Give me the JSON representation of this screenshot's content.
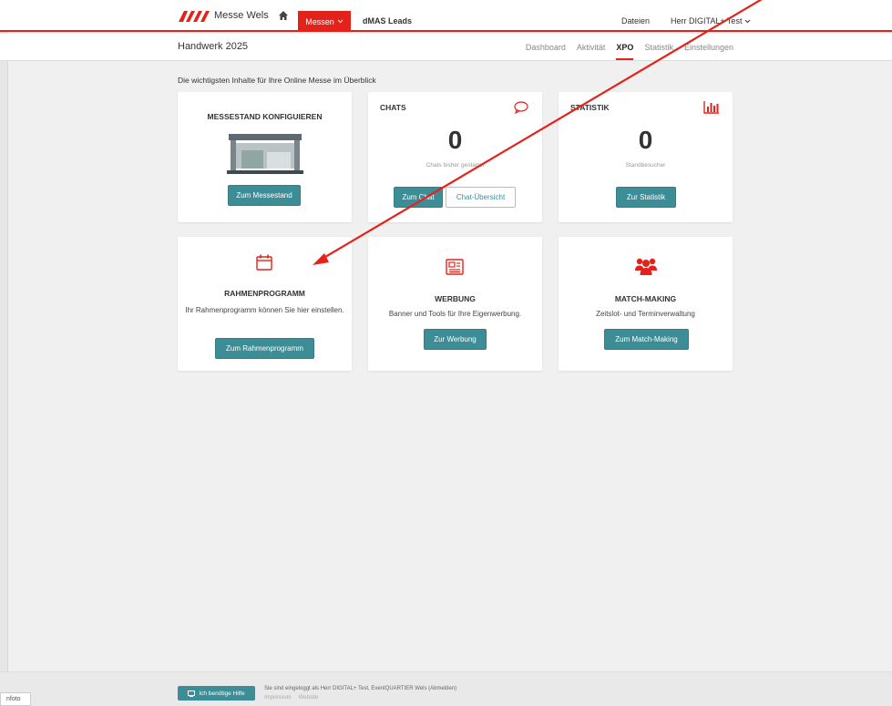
{
  "header": {
    "logo_text": "Messe Wels",
    "messen_label": "Messen",
    "dmas_label": "dMAS Leads",
    "dateien_label": "Dateien",
    "user_label": "Herr DIGITAL+ Test"
  },
  "subheader": {
    "title": "Handwerk 2025",
    "tabs": [
      {
        "label": "Dashboard"
      },
      {
        "label": "Aktivität"
      },
      {
        "label": "XPO"
      },
      {
        "label": "Statistik"
      },
      {
        "label": "Einstellungen"
      }
    ],
    "active_tab": "XPO"
  },
  "intro": "Die wichtigsten Inhalte für Ihre Online Messe im Überblick",
  "cards": {
    "messestand": {
      "title": "MESSESTAND KONFIGUIEREN",
      "button": "Zum Messestand"
    },
    "chats": {
      "title": "CHATS",
      "count": "0",
      "caption": "Chats bisher gestartet",
      "button_primary": "Zum Chat",
      "button_secondary": "Chat-Übersicht"
    },
    "statistik": {
      "title": "STATISTIK",
      "count": "0",
      "caption": "Standbesucher",
      "button": "Zur Statistik"
    },
    "rahmenprogramm": {
      "title": "RAHMENPROGRAMM",
      "desc": "Ihr Rahmenprogramm können Sie hier einstellen.",
      "button": "Zum Rahmenprogramm"
    },
    "werbung": {
      "title": "WERBUNG",
      "desc": "Banner und Tools für Ihre Eigenwerbung.",
      "button": "Zur Werbung"
    },
    "matchmaking": {
      "title": "MATCH-MAKING",
      "desc": "Zeitslot- und Terminverwaltung",
      "button": "Zum Match-Making"
    }
  },
  "footer": {
    "help_label": "Ich benötige Hilfe",
    "status_text": "Sie sind eingeloggt als Herr DIGITAL+ Test, EventQUARTIER Wels (Abmelden)",
    "links": [
      "Impressum",
      "Website"
    ]
  },
  "corner_label": "nfoto",
  "colors": {
    "accent_red": "#e3231b",
    "button_teal": "#3d8d96"
  },
  "icons": [
    "home-icon",
    "chevron-down-icon",
    "chat-bubble-icon",
    "bar-chart-icon",
    "calendar-icon",
    "newspaper-icon",
    "users-icon",
    "help-icon"
  ]
}
